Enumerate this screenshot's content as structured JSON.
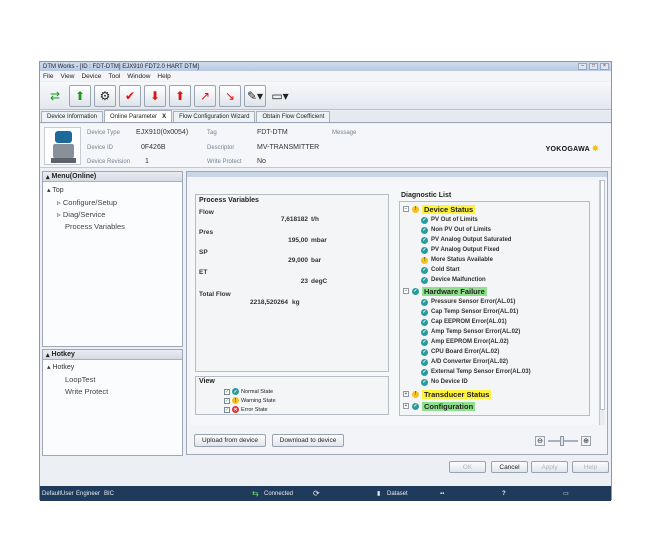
{
  "window": {
    "title": "DTM Works - [ID : FDT-DTM] EJX910 FDT2.0 HART DTM]"
  },
  "menu": [
    "File",
    "View",
    "Device",
    "Tool",
    "Window",
    "Help"
  ],
  "tabs": [
    {
      "label": "Device Information"
    },
    {
      "label": "Online Parameter",
      "close": "X"
    },
    {
      "label": "Flow Configuration Wizard"
    },
    {
      "label": "Obtain Flow Coefficient"
    }
  ],
  "device": {
    "type_label": "Device Type",
    "type_value": "EJX910(0x0054)",
    "id_label": "Device ID",
    "id_value": "0F426B",
    "rev_label": "Device Revision",
    "rev_value": "1",
    "tag_label": "Tag",
    "tag_value": "FDT-DTM",
    "desc_label": "Descriptor",
    "desc_value": "MV-TRANSMITTER",
    "wp_label": "Write Protect",
    "wp_value": "No",
    "msg_label": "Message",
    "msg_value": "",
    "logo": "YOKOGAWA"
  },
  "menu_panel": {
    "title": "Menu(Online)",
    "top": "Top",
    "items": [
      "Configure/Setup",
      "Diag/Service",
      "Process Variables"
    ]
  },
  "hotkey_panel": {
    "title": "Hotkey",
    "root": "Hotkey",
    "items": [
      "LoopTest",
      "Write Protect"
    ]
  },
  "process_variables": {
    "title": "Process Variables",
    "rows": [
      {
        "label": "Flow",
        "value": "7,618182",
        "unit": "t/h"
      },
      {
        "label": "Pres",
        "value": "195,00",
        "unit": "mbar"
      },
      {
        "label": "SP",
        "value": "29,000",
        "unit": "bar"
      },
      {
        "label": "ET",
        "value": "23",
        "unit": "degC"
      },
      {
        "label": "Total Flow",
        "value": "2218,520264",
        "unit": "kg"
      }
    ]
  },
  "view_box": {
    "title": "View",
    "items": [
      "Normal State",
      "Warning State",
      "Error State"
    ]
  },
  "diagnostic": {
    "title": "Diagnostic List",
    "categories": [
      {
        "name": "Device Status",
        "items": [
          "PV Out of Limits",
          "Non PV Out of Limits",
          "PV Analog Output Saturated",
          "PV Analog Output Fixed",
          "More Status Available",
          "Cold Start",
          "Device Malfunction"
        ]
      },
      {
        "name": "Hardware Failure",
        "items": [
          "Pressure Sensor Error(AL.01)",
          "Cap Temp Sensor Error(AL.01)",
          "Cap EEPROM Error(AL.01)",
          "Amp Temp Sensor Error(AL.02)",
          "Amp EEPROM Error(AL.02)",
          "CPU Board Error(AL.02)",
          "A/D Converter Error(AL.02)",
          "External Temp Sensor Error(AL.03)",
          "No Device ID"
        ]
      },
      {
        "name": "Transducer Status",
        "items": []
      },
      {
        "name": "Configuration",
        "items": []
      }
    ]
  },
  "buttons": {
    "upload": "Upload from device",
    "download": "Download to device",
    "ok": "OK",
    "cancel": "Cancel",
    "apply": "Apply",
    "help": "Help"
  },
  "statusbar": {
    "user": "DefaultUser",
    "role": "Engineer",
    "mode": "BIC",
    "connection": "Connected",
    "dataset": "Dataset"
  }
}
